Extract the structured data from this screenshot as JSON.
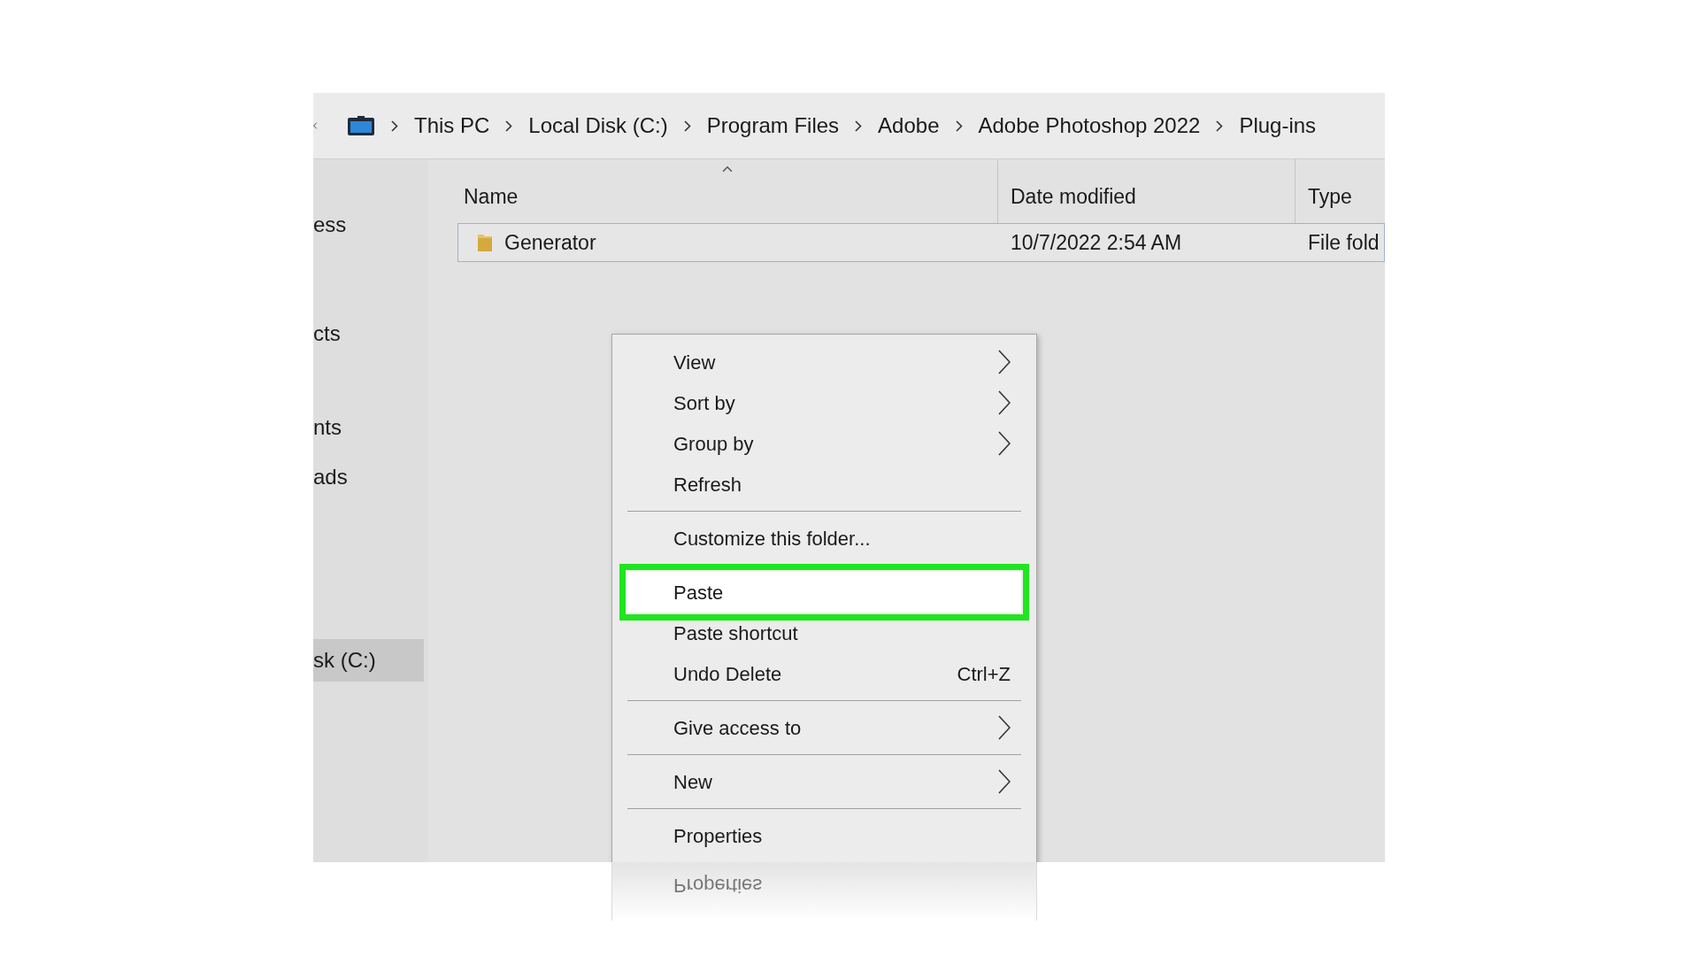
{
  "address_bar": {
    "crumbs": [
      "This PC",
      "Local Disk (C:)",
      "Program Files",
      "Adobe",
      "Adobe Photoshop 2022",
      "Plug-ins"
    ]
  },
  "sidebar": {
    "items": [
      {
        "label": "ess",
        "selected": false
      },
      {
        "label": "cts",
        "selected": false
      },
      {
        "label": "nts",
        "selected": false
      },
      {
        "label": "ads",
        "selected": false
      },
      {
        "label": "sk (C:)",
        "selected": true
      }
    ]
  },
  "columns": [
    {
      "label": "Name",
      "sorted": true
    },
    {
      "label": "Date modified",
      "sorted": false
    },
    {
      "label": "Type",
      "sorted": false
    }
  ],
  "rows": [
    {
      "cells": [
        "Generator",
        "10/7/2022 2:54 AM",
        "File fold"
      ],
      "selected": true
    }
  ],
  "context_menu": {
    "items": [
      {
        "kind": "item",
        "label": "View",
        "submenu": true,
        "highlighted": false
      },
      {
        "kind": "item",
        "label": "Sort by",
        "submenu": true,
        "highlighted": false
      },
      {
        "kind": "item",
        "label": "Group by",
        "submenu": true,
        "highlighted": false
      },
      {
        "kind": "item",
        "label": "Refresh",
        "submenu": false,
        "highlighted": false
      },
      {
        "kind": "separator"
      },
      {
        "kind": "item",
        "label": "Customize this folder...",
        "submenu": false,
        "highlighted": false
      },
      {
        "kind": "separator"
      },
      {
        "kind": "item",
        "label": "Paste",
        "submenu": false,
        "highlighted": true
      },
      {
        "kind": "item",
        "label": "Paste shortcut",
        "submenu": false,
        "highlighted": false
      },
      {
        "kind": "item",
        "label": "Undo Delete",
        "shortcut": "Ctrl+Z",
        "submenu": false,
        "highlighted": false
      },
      {
        "kind": "separator"
      },
      {
        "kind": "item",
        "label": "Give access to",
        "submenu": true,
        "highlighted": false
      },
      {
        "kind": "separator"
      },
      {
        "kind": "item",
        "label": "New",
        "submenu": true,
        "highlighted": false
      },
      {
        "kind": "separator"
      },
      {
        "kind": "item",
        "label": "Properties",
        "submenu": false,
        "highlighted": false
      }
    ]
  },
  "reflection": {
    "text": "Properties"
  }
}
